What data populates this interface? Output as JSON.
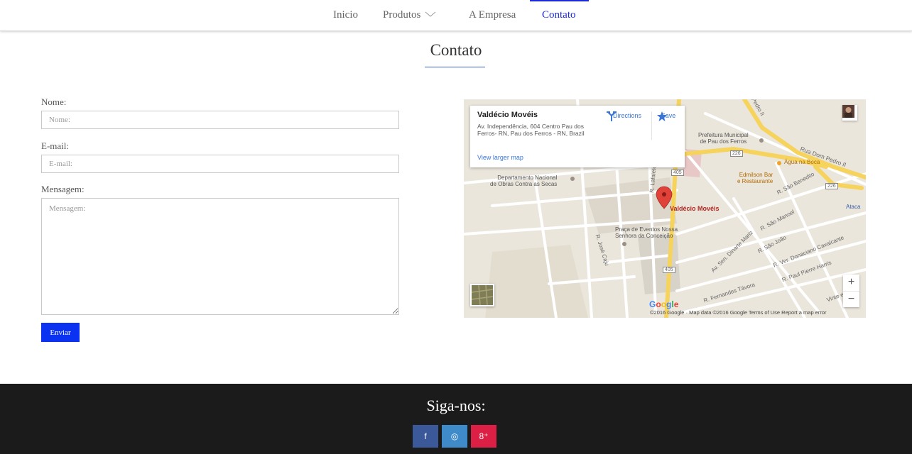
{
  "nav": {
    "items": [
      {
        "label": "Inicio"
      },
      {
        "label": "Produtos"
      },
      {
        "label": "A Empresa"
      },
      {
        "label": "Contato"
      }
    ]
  },
  "page": {
    "title": "Contato"
  },
  "form": {
    "name_label": "Nome:",
    "name_placeholder": "Nome:",
    "email_label": "E-mail:",
    "email_placeholder": "E-mail:",
    "message_label": "Mensagem:",
    "message_placeholder": "Mensagem:",
    "submit_label": "Enviar"
  },
  "map": {
    "place_name": "Valdécio Movéis",
    "address": "Av. Independência, 604 Centro Pau dos Ferros- RN, Pau dos Ferros - RN, Brazil",
    "directions_label": "Directions",
    "save_label": "Save",
    "larger_map_label": "View larger map",
    "pin_label": "Valdécio Movéis",
    "labels": {
      "prefeitura": "Prefeitura Municipal",
      "prefeitura2": "de Pau dos Ferros",
      "agua": "Água na Boca",
      "edmilson": "Edmilson Bar",
      "edmilson2": "e Restaurante",
      "dnocs": "Departamento Nacional",
      "dnocs2": "de Obras Contra as Secas",
      "praca": "Praça de Eventos Nossa",
      "praca2": "Senhora da Conceição",
      "ataca": "Ataca"
    },
    "roads": {
      "dom_pedro": "Rua Dom Pedro II",
      "sao_benedito": "R. São Benedito",
      "sao_manoel": "R. São Manoel",
      "sao_joao": "R. São João",
      "donaciano": "R. Ver. Donaciano Cavalcante",
      "dinarte": "Av. Sen. Dinarte Mariz",
      "pierre": "R. Paul Pierre Harris",
      "tavora": "R. Fernandes Távora",
      "jose_caju": "R. José Caju",
      "lafaiete": "R. Lafaiete",
      "pedro_ii_top": "Pedro II",
      "vinte": "Vinte e Set"
    },
    "shields": [
      "226",
      "405",
      "226",
      "405"
    ],
    "zoom_in": "+",
    "zoom_out": "−",
    "google": "Google",
    "attribution": "©2016 Google · Map data ©2016 Google    Terms of Use    Report a map error"
  },
  "footer": {
    "title": "Siga-nos:",
    "social": [
      {
        "label": "f",
        "color": "#3b5998"
      },
      {
        "label": "◎",
        "color": "#3f8ac9"
      },
      {
        "label": "8⁺",
        "color": "#dc1f45"
      }
    ]
  },
  "colors": {
    "accent": "#1a2ad6",
    "button": "#0a32f0",
    "footer_bg": "#1b1b1b"
  }
}
